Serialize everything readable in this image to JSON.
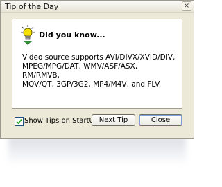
{
  "window": {
    "title": "Tip of the Day",
    "close_glyph": "×"
  },
  "tip": {
    "icon": "lightbulb-icon",
    "heading": "Did you know...",
    "lines": [
      "Video source supports AVI/DIVX/XVID/DIV,",
      "MPEG/MPG/DAT, WMV/ASF/ASX, RM/RMVB,",
      "MOV/QT, 3GP/3G2, MP4/M4V, and FLV."
    ]
  },
  "options": {
    "show_tips_label": "Show Tips on StartUp",
    "show_tips_checked": true
  },
  "buttons": {
    "next_tip": "Next Tip",
    "close": "Close"
  },
  "colors": {
    "dialog_bg": "#ece9d8",
    "bulb_yellow": "#f5e000",
    "accent_green": "#2f8a2f"
  }
}
